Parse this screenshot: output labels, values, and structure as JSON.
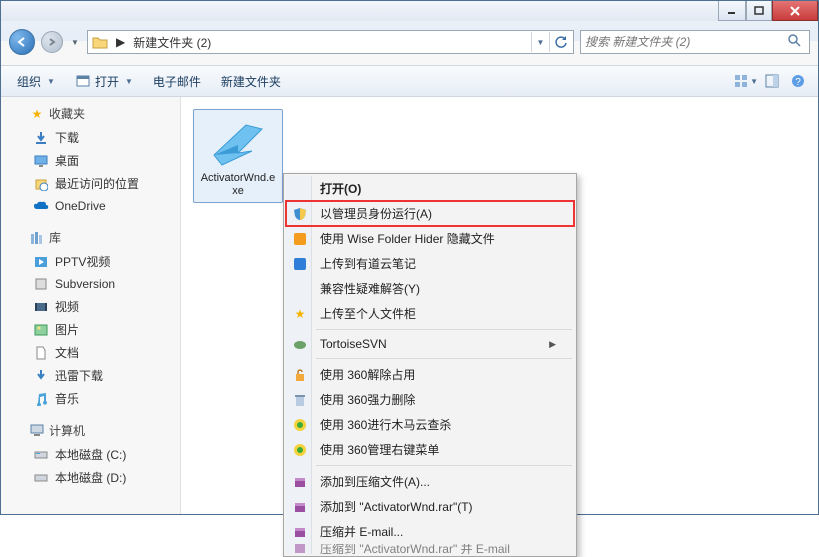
{
  "window": {
    "title": "新建文件夹 (2)"
  },
  "address": {
    "arrow": "▶",
    "crumb1": "新建文件夹 (2)"
  },
  "search": {
    "placeholder": "搜索 新建文件夹 (2)"
  },
  "toolbar": {
    "organize": "组织",
    "open": "打开",
    "email": "电子邮件",
    "new_folder": "新建文件夹"
  },
  "sidebar": {
    "favorites": {
      "label": "收藏夹",
      "items": [
        "下载",
        "桌面",
        "最近访问的位置",
        "OneDrive"
      ]
    },
    "libraries": {
      "label": "库",
      "items": [
        "PPTV视频",
        "Subversion",
        "视频",
        "图片",
        "文档",
        "迅雷下载",
        "音乐"
      ]
    },
    "computer": {
      "label": "计算机",
      "items": [
        "本地磁盘 (C:)",
        "本地磁盘 (D:)"
      ]
    }
  },
  "file": {
    "name": "ActivatorWnd.exe"
  },
  "context_menu": {
    "open": "打开(O)",
    "run_as_admin": "以管理员身份运行(A)",
    "wise_hide": "使用 Wise Folder Hider 隐藏文件",
    "youdao": "上传到有道云笔记",
    "compat": "兼容性疑难解答(Y)",
    "personal_cabinet": "上传至个人文件柜",
    "tortoise": "TortoiseSVN",
    "unlock360": "使用 360解除占用",
    "force_delete360": "使用 360强力删除",
    "trojan360": "使用 360进行木马云查杀",
    "rmenu360": "使用 360管理右键菜单",
    "add_archive": "添加到压缩文件(A)...",
    "add_to_rar": "添加到 \"ActivatorWnd.rar\"(T)",
    "compress_email": "压缩并 E-mail...",
    "compress_rar_email_cut": "压缩到 \"ActivatorWnd.rar\" 并 E-mail"
  }
}
